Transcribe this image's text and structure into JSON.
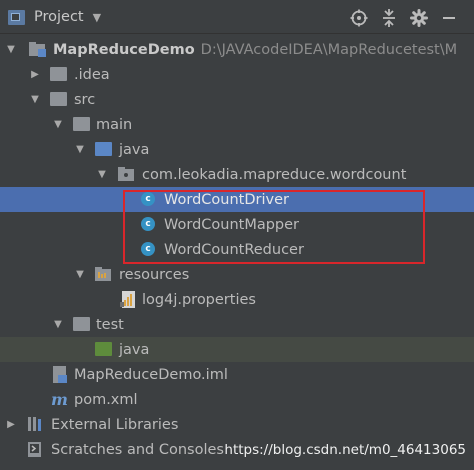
{
  "panel": {
    "title": "Project",
    "caret": "▼",
    "actions": [
      {
        "name": "locate-icon",
        "glyph": "⊕"
      },
      {
        "name": "collapse-all-icon",
        "glyph": "≑"
      },
      {
        "name": "gear-icon",
        "glyph": "⚙"
      },
      {
        "name": "hide-icon",
        "glyph": "—"
      }
    ]
  },
  "tree": {
    "project": {
      "name": "MapReduceDemo",
      "path": "D:\\JAVAcodeIDEA\\MapReducetest\\M"
    },
    "idea": ".idea",
    "src": "src",
    "main": "main",
    "java": "java",
    "package": "com.leokadia.mapreduce.wordcount",
    "classes": [
      "WordCountDriver",
      "WordCountMapper",
      "WordCountReducer"
    ],
    "class_badge": "c",
    "resources": "resources",
    "log4j": "log4j.properties",
    "test": "test",
    "test_java": "java",
    "iml": "MapReduceDemo.iml",
    "pom": "pom.xml",
    "external_libraries": "External Libraries",
    "scratches": "Scratches and Consoles"
  },
  "watermark": "https://blog.csdn.net/m0_46413065",
  "colors": {
    "selection": "#4b6eaf",
    "highlight_box": "#d9262b",
    "class_icon": "#3592c4"
  }
}
